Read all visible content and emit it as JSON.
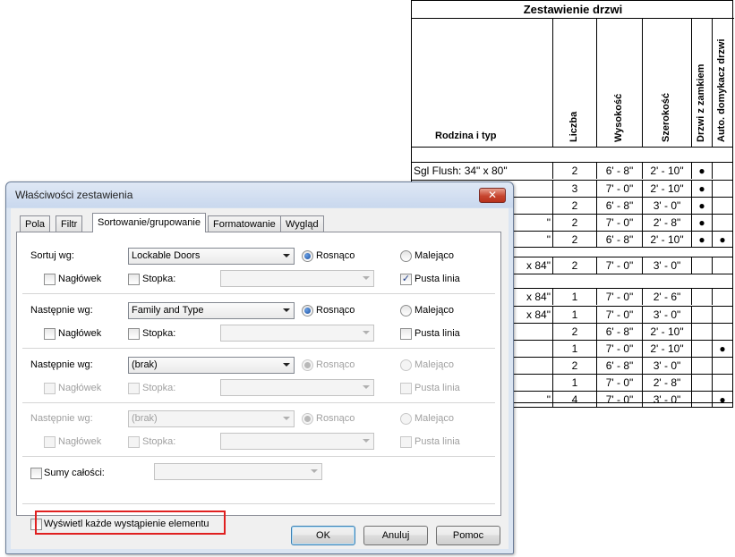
{
  "schedule": {
    "title": "Zestawienie drzwi",
    "headers": [
      "Rodzina i typ",
      "Liczba",
      "Wysokość",
      "Szerokość",
      "Drzwi z zamkiem",
      "Auto. domykacz drzwi"
    ],
    "groups": [
      [
        [
          "Sgl Flush: 34\" x 80\"",
          "2",
          "6' - 8\"",
          "2' - 10\"",
          "●",
          ""
        ],
        [
          "",
          "3",
          "7' - 0\"",
          "2' - 10\"",
          "●",
          ""
        ],
        [
          "",
          "2",
          "6' - 8\"",
          "3' - 0\"",
          "●",
          ""
        ],
        [
          "\"",
          "2",
          "7' - 0\"",
          "2' - 8\"",
          "●",
          ""
        ],
        [
          "\"",
          "2",
          "6' - 8\"",
          "2' - 10\"",
          "●",
          "●"
        ]
      ],
      [
        [
          "x 84\"",
          "2",
          "7' - 0\"",
          "3' - 0\"",
          "",
          ""
        ]
      ],
      [
        [
          "x 84\"",
          "1",
          "7' - 0\"",
          "2' - 6\"",
          "",
          ""
        ],
        [
          "x 84\"",
          "1",
          "7' - 0\"",
          "3' - 0\"",
          "",
          ""
        ],
        [
          "",
          "2",
          "6' - 8\"",
          "2' - 10\"",
          "",
          ""
        ],
        [
          "",
          "1",
          "7' - 0\"",
          "2' - 10\"",
          "",
          "●"
        ],
        [
          "",
          "2",
          "6' - 8\"",
          "3' - 0\"",
          "",
          ""
        ],
        [
          "",
          "1",
          "7' - 0\"",
          "2' - 8\"",
          "",
          ""
        ],
        [
          "\"",
          "4",
          "7' - 0\"",
          "3' - 0\"",
          "",
          "●"
        ]
      ]
    ]
  },
  "dialog": {
    "title": "Właściwości zestawienia",
    "close_label": "✕",
    "tabs": [
      "Pola",
      "Filtr",
      "Sortowanie/grupowanie",
      "Formatowanie",
      "Wygląd"
    ],
    "active_tab": "Sortowanie/grupowanie",
    "sort_levels": [
      {
        "label": "Sortuj wg:",
        "value": "Lockable Doors",
        "ascending": "Rosnąco",
        "descending": "Malejąco",
        "header": "Nagłówek",
        "footer": "Stopka:",
        "blank_line": "Pusta linia",
        "blank_line_checked": true,
        "enabled": true
      },
      {
        "label": "Następnie wg:",
        "value": "Family and Type",
        "ascending": "Rosnąco",
        "descending": "Malejąco",
        "header": "Nagłówek",
        "footer": "Stopka:",
        "blank_line": "Pusta linia",
        "blank_line_checked": false,
        "enabled": true
      },
      {
        "label": "Następnie wg:",
        "value": "(brak)",
        "ascending": "Rosnąco",
        "descending": "Malejąco",
        "header": "Nagłówek",
        "footer": "Stopka:",
        "blank_line": "Pusta linia",
        "blank_line_checked": false,
        "enabled": true
      },
      {
        "label": "Następnie wg:",
        "value": "(brak)",
        "ascending": "Rosnąco",
        "descending": "Malejąco",
        "header": "Nagłówek",
        "footer": "Stopka:",
        "blank_line": "Pusta linia",
        "blank_line_checked": false,
        "enabled": false
      }
    ],
    "grand_totals": "Sumy całości:",
    "itemize": "Wyświetl każde wystąpienie elementu",
    "buttons": {
      "ok": "OK",
      "cancel": "Anuluj",
      "help": "Pomoc"
    }
  },
  "colors": {
    "highlight": "#e02020",
    "close_button": "#c7452f"
  }
}
